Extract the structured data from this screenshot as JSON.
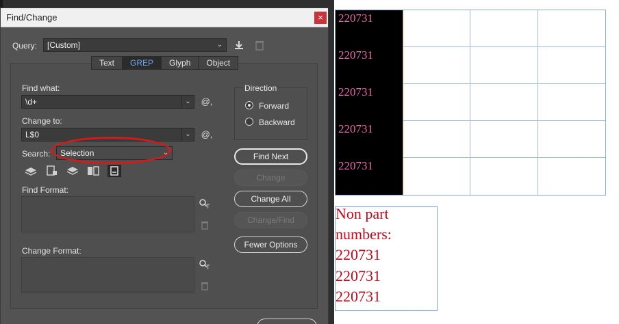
{
  "dialog": {
    "title": "Find/Change",
    "close_label": "×",
    "query": {
      "label": "Query:",
      "value": "[Custom]"
    },
    "tabs": [
      {
        "label": "Text",
        "active": false
      },
      {
        "label": "GREP",
        "active": true
      },
      {
        "label": "Glyph",
        "active": false
      },
      {
        "label": "Object",
        "active": false
      }
    ],
    "find_what": {
      "label": "Find what:",
      "value": "\\d+"
    },
    "change_to": {
      "label": "Change to:",
      "value": "L$0"
    },
    "search": {
      "label": "Search:",
      "value": "Selection"
    },
    "direction": {
      "label": "Direction",
      "forward": "Forward",
      "backward": "Backward",
      "selected": "Forward"
    },
    "buttons": {
      "find_next": "Find Next",
      "change": "Change",
      "change_all": "Change All",
      "change_find": "Change/Find",
      "fewer_options": "Fewer Options"
    },
    "find_format": {
      "label": "Find Format:"
    },
    "change_format": {
      "label": "Change Format:"
    },
    "special_char_glyph": "@,",
    "annotation_color": "#d61a1a"
  },
  "document": {
    "table_cells": [
      "220731",
      "220731",
      "220731",
      "220731",
      "220731"
    ],
    "text_frame_lines": [
      "Non part",
      "numbers:",
      "220731",
      "220731",
      "220731"
    ],
    "colors": {
      "cell_text": "#e56aa8",
      "frame_text": "#c4081b",
      "highlight_column": "#000000"
    }
  }
}
